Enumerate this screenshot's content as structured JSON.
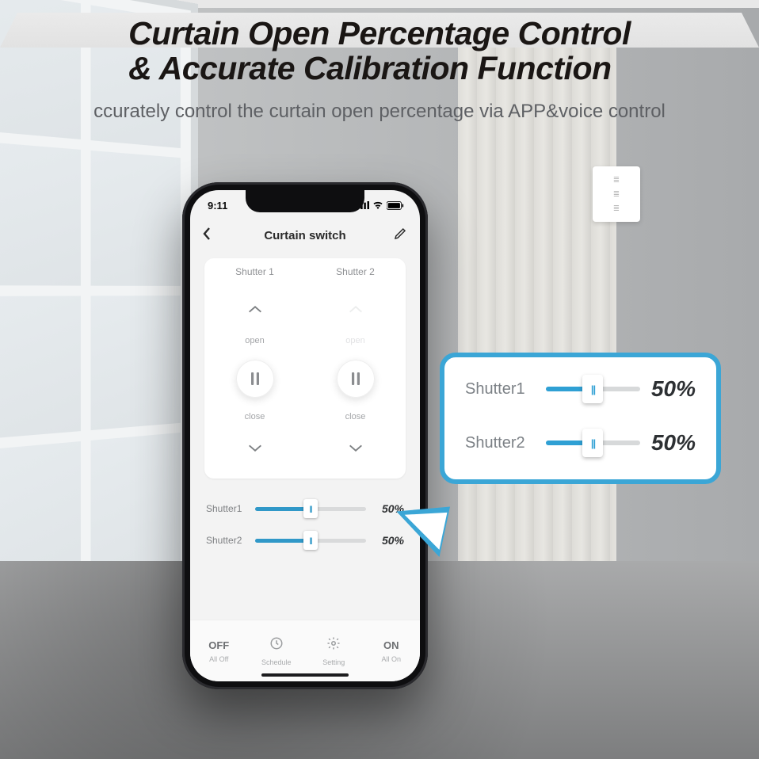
{
  "hero": {
    "title_l1": "Curtain Open Percentage Control",
    "title_l2": "& Accurate Calibration Function",
    "subtitle": "ccurately control the curtain open percentage via APP&voice control"
  },
  "phone": {
    "status": {
      "time": "9:11"
    },
    "nav": {
      "title": "Curtain switch"
    },
    "shutters": [
      {
        "label": "Shutter 1",
        "open": "open",
        "close": "close"
      },
      {
        "label": "Shutter 2",
        "open": "open",
        "close": "close"
      }
    ],
    "sliders": [
      {
        "label": "Shutter1",
        "percent_display": "50%",
        "percent": 50
      },
      {
        "label": "Shutter2",
        "percent_display": "50%",
        "percent": 50
      }
    ],
    "bottom": [
      {
        "top": "OFF",
        "sub": "All Off"
      },
      {
        "icon": "clock",
        "sub": "Schedule"
      },
      {
        "icon": "gear",
        "sub": "Setting"
      },
      {
        "top": "ON",
        "sub": "All On"
      }
    ]
  },
  "callout": [
    {
      "label": "Shutter1",
      "percent_display": "50%",
      "percent": 50
    },
    {
      "label": "Shutter2",
      "percent_display": "50%",
      "percent": 50
    }
  ]
}
